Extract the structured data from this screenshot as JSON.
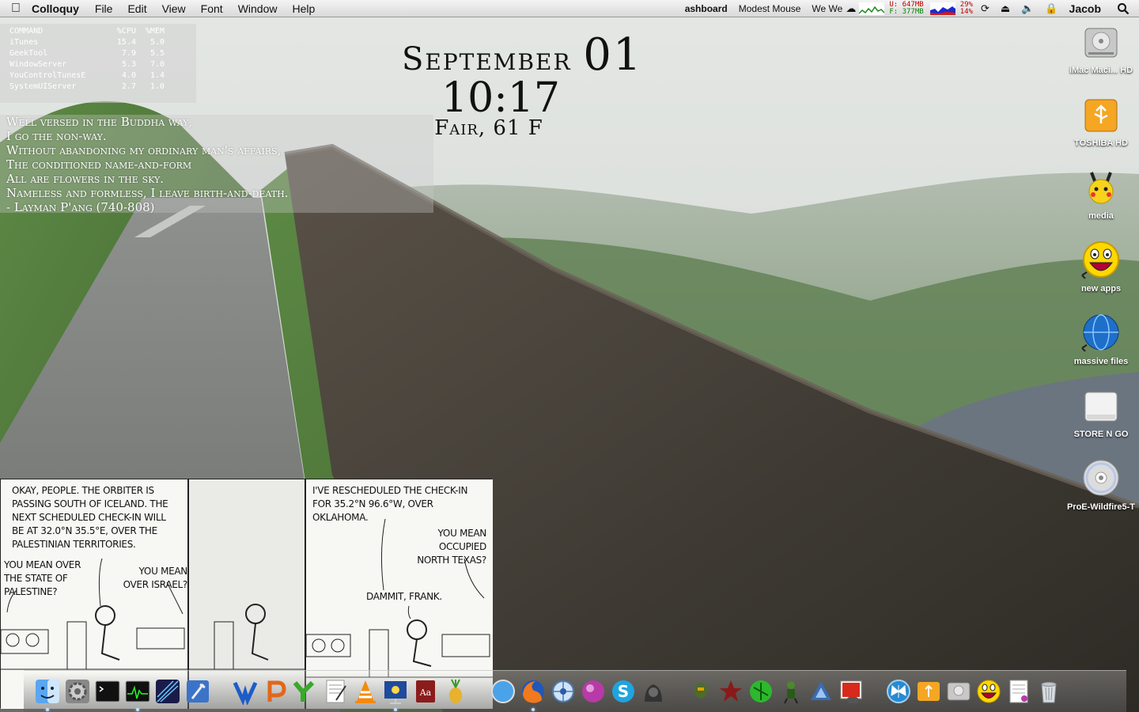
{
  "menubar": {
    "app": "Colloquy",
    "menus": [
      "File",
      "Edit",
      "View",
      "Font",
      "Window",
      "Help"
    ],
    "right": {
      "dashboard": "ashboard",
      "now_playing": "Modest Mouse",
      "track": "We We",
      "mem_used": "U: 647MB",
      "mem_free": "F: 377MB",
      "cpu1": "29%",
      "cpu2": "14%",
      "user": "Jacob"
    }
  },
  "processes": {
    "headers": [
      "COMMAND",
      "%CPU",
      "%MEM"
    ],
    "rows": [
      [
        "iTunes",
        "15.4",
        "5.0"
      ],
      [
        "GeekTool",
        "7.9",
        "5.5"
      ],
      [
        "WindowServer",
        "5.3",
        "7.0"
      ],
      [
        "YouControlTunesE",
        "4.0",
        "1.4"
      ],
      [
        "SystemUIServer",
        "2.7",
        "1.0"
      ]
    ]
  },
  "quote": {
    "lines": [
      "Well versed in the Buddha way,",
      "I go the non-way.",
      "Without abandoning my ordinary man's affairs,",
      "The conditioned name-and-form",
      "All are flowers in the sky.",
      "Nameless and formless, I leave birth-and-death.",
      "- Layman P'ang (740-808)"
    ]
  },
  "clock": {
    "month": "September",
    "day": "01",
    "time": "10:17",
    "weather": "Fair, 61 F"
  },
  "desktop_icons": [
    {
      "label": "iMac Maci... HD",
      "icon": "hard-drive-icon"
    },
    {
      "label": "TOSHIBA HD",
      "icon": "usb-drive-icon"
    },
    {
      "label": "media",
      "icon": "pikachu-folder-icon"
    },
    {
      "label": "new apps",
      "icon": "smiley-alias-icon"
    },
    {
      "label": "massive files",
      "icon": "globe-alias-icon"
    },
    {
      "label": "STORE N GO",
      "icon": "removable-drive-icon"
    },
    {
      "label": "ProE-Wildfire5-T",
      "icon": "cd-icon"
    }
  ],
  "comic": {
    "panel1_top": "Okay, people. The orbiter is passing south of Iceland. The next scheduled check-in will be at 32.0°N 35.5°E, over the Palestinian Territories.",
    "panel1_left": "You mean over the State of Palestine?",
    "panel1_right": "You mean over Israel?",
    "panel3_top": "I've rescheduled the check-in for 35.2°N 96.6°W, over Oklahoma.",
    "panel3_right": "You mean occupied North Texas?",
    "panel3_bottom": "Dammit, Frank."
  },
  "dock_icons": [
    "finder-icon",
    "system-preferences-icon",
    "terminal-icon",
    "activity-monitor-icon",
    "front-row-icon",
    "xcode-icon",
    "gap",
    "word-icon",
    "powerpoint-icon",
    "yahoo-messenger-icon",
    "textedit-icon",
    "vlc-icon",
    "keynote-icon",
    "dictionary-icon",
    "cocktail-icon",
    "gap",
    "safari-icon",
    "firefox-icon",
    "camino-icon",
    "itunes-ball-icon",
    "skype-icon",
    "adium-icon",
    "gap",
    "halo-icon",
    "wolfenstein-icon",
    "green-orb-icon",
    "game-character-icon",
    "triangle-game-icon",
    "game-controller-icon",
    "gap",
    "butterfly-icon",
    "usb-folder-icon",
    "hard-drive-dock-icon",
    "smiley-dock-icon",
    "document-icon",
    "trash-icon"
  ],
  "colors": {
    "menubar": "#e6e6e6",
    "desktop_text": "#ffffff",
    "clock_text": "#111111"
  }
}
